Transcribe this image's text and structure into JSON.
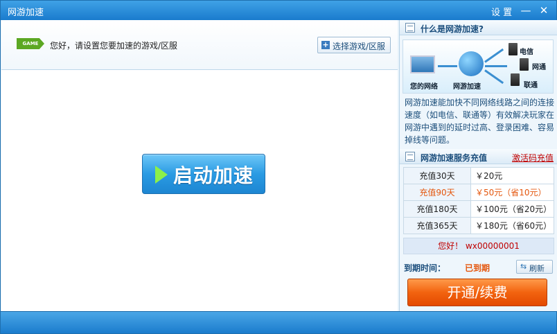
{
  "window": {
    "title": "网游加速",
    "settings_label": "设 置",
    "minimize_glyph": "—",
    "close_glyph": "✕"
  },
  "welcome": {
    "game_badge": "GAME",
    "text": "您好，请设置您要加速的游戏/区服",
    "select_button": "选择游戏/区服"
  },
  "main": {
    "start_button": "启动加速"
  },
  "about": {
    "heading": "什么是网游加速?",
    "diagram": {
      "your_network": "您的网络",
      "accelerator": "网游加速",
      "telecom": "电信",
      "netcom": "网通",
      "unicom": "联通"
    },
    "description": "网游加速能加快不同网络线路之间的连接速度（如电信、联通等）有效解决玩家在网游中遇到的延时过高、登录困难、容易掉线等问题。"
  },
  "recharge": {
    "heading": "网游加速服务充值",
    "activation_link": "激活码充值",
    "plans": [
      {
        "plan": "充值30天",
        "price": "￥20元",
        "highlight": false
      },
      {
        "plan": "充值90天",
        "price": "￥50元（省10元）",
        "highlight": true
      },
      {
        "plan": "充值180天",
        "price": "￥100元（省20元）",
        "highlight": false
      },
      {
        "plan": "充值365天",
        "price": "￥180元（省60元）",
        "highlight": false
      }
    ]
  },
  "account": {
    "greeting": "您好！",
    "user_id": "wx00000001",
    "expire_label": "到期时间：",
    "expire_value": "已到期",
    "refresh_button": "刷新",
    "pay_button": "开通/续费"
  },
  "colors": {
    "accent": "#1a7bcd",
    "highlight": "#e4560d",
    "alert": "#c00000"
  }
}
